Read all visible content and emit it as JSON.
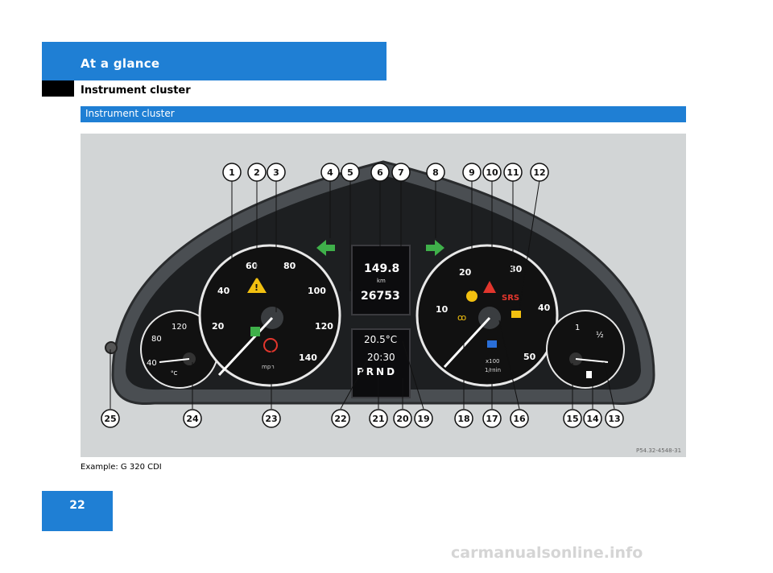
{
  "header": {
    "section_tab": "At a glance",
    "subsection": "Instrument cluster"
  },
  "section_bar": {
    "title": "Instrument cluster"
  },
  "figure": {
    "display": {
      "trip": "149.8",
      "trip_unit": "km",
      "odometer": "26753",
      "temperature": "20.5°C",
      "clock": "20:30",
      "gear_indicator": "PRND",
      "tacho_unit_1": "x100",
      "tacho_unit_2": "1/min",
      "speed_unit": "mph",
      "srs_label": "SRS",
      "coolant_unit": "°C",
      "fuel_half": "½"
    },
    "speedo_ticks": [
      "20",
      "40",
      "60",
      "80",
      "100",
      "120",
      "140"
    ],
    "tacho_ticks": [
      "10",
      "20",
      "30",
      "40",
      "50"
    ],
    "coolant_ticks": [
      "40",
      "80",
      "120"
    ],
    "fuel_ticks": [
      "1",
      "½"
    ],
    "callouts_top": [
      "1",
      "2",
      "3",
      "4",
      "5",
      "6",
      "7",
      "8",
      "9",
      "10",
      "11",
      "12"
    ],
    "callouts_bottom": [
      "25",
      "24",
      "23",
      "22",
      "21",
      "20",
      "19",
      "18",
      "17",
      "16",
      "15",
      "14",
      "13"
    ],
    "image_code": "P54.32-4548-31"
  },
  "caption": "Example: G 320 CDI",
  "page_number": "22",
  "watermark": "carmanualsonline.info",
  "colors": {
    "accent_blue": "#1f7fd4",
    "figure_bg": "#d2d5d6",
    "arrow_green": "#3fb04a",
    "warning_red": "#e2362d",
    "warning_yellow": "#f2c010"
  }
}
